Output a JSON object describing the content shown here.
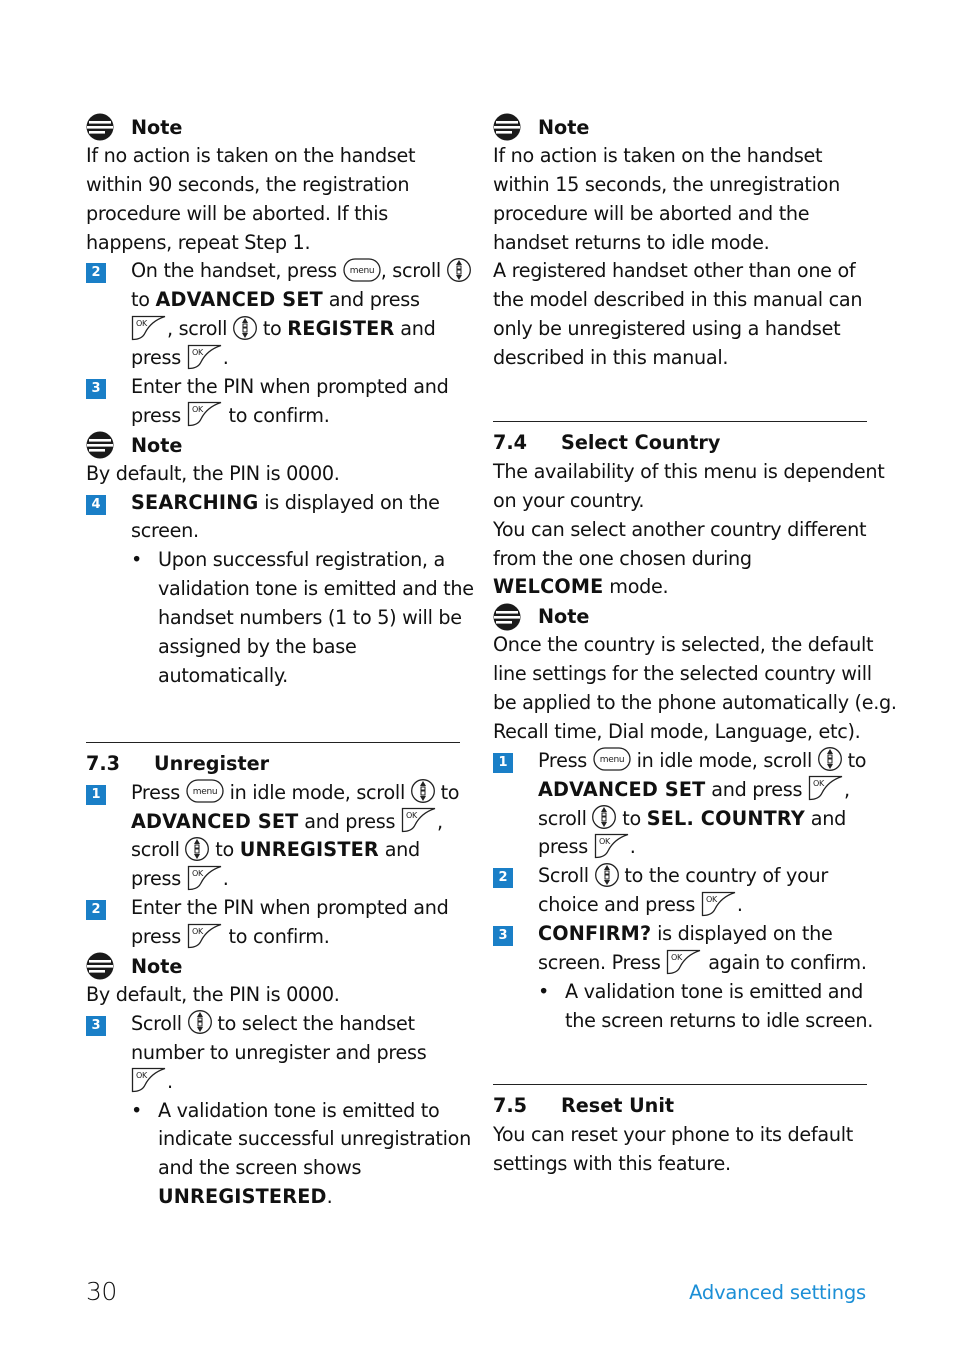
{
  "page": {
    "number": "30",
    "section_footer": "Advanced settings",
    "accent_color": "#1a7fc7",
    "footer_color": "#1c8fd6"
  },
  "icons": {
    "note": "note-icon",
    "menu_key": "menu",
    "ok_key": "OK",
    "scroll_key": "scroll-icon"
  },
  "left": {
    "note1": {
      "title": "Note",
      "lines": [
        "If no action is taken on the handset",
        "within 90 seconds, the registration",
        "procedure will be aborted. If this",
        "happens, repeat Step 1."
      ]
    },
    "step2": {
      "num": "2",
      "l1a": "On the handset, press ",
      "l1b": ", scroll ",
      "l2a": "to ",
      "l2b": "ADVANCED SET",
      "l2c": " and press",
      "l3a": ", scroll ",
      "l3b": " to ",
      "l3c": "REGISTER",
      "l3d": " and",
      "l4a": "press ",
      "l4b": "."
    },
    "step3": {
      "num": "3",
      "l1": "Enter the PIN when prompted and",
      "l2a": "press ",
      "l2b": " to confirm."
    },
    "note2": {
      "title": "Note",
      "text": "By default, the PIN is 0000."
    },
    "step4": {
      "num": "4",
      "l1a": "SEARCHING",
      "l1b": " is displayed on the",
      "l2": "screen.",
      "bullet": [
        "Upon successful registration, a",
        "validation tone is emitted and the",
        "handset numbers (1 to 5) will be",
        "assigned by the base",
        "automatically."
      ]
    },
    "sec73": {
      "num": "7.3",
      "title": "Unregister",
      "step1": {
        "num": "1",
        "l1a": "Press ",
        "l1b": " in idle mode, scroll ",
        "l1c": " to",
        "l2a": "ADVANCED SET",
        "l2b": " and press ",
        "l2c": ",",
        "l3a": "scroll ",
        "l3b": " to ",
        "l3c": "UNREGISTER",
        "l3d": " and",
        "l4a": "press ",
        "l4b": "."
      },
      "step2": {
        "num": "2",
        "l1": "Enter the PIN when prompted and",
        "l2a": "press ",
        "l2b": " to confirm."
      },
      "note": {
        "title": "Note",
        "text": "By default, the PIN is 0000."
      },
      "step3": {
        "num": "3",
        "l1a": "Scroll ",
        "l1b": " to select the handset",
        "l2": "number to unregister and press",
        "l3b": ".",
        "bullet": [
          "A validation tone is emitted to",
          "indicate successful unregistration",
          "and the screen shows"
        ],
        "bullet_last_bold": "UNREGISTERED",
        "bullet_last_end": "."
      }
    }
  },
  "right": {
    "note1": {
      "title": "Note",
      "lines": [
        "If no action is taken on the handset",
        "within 15 seconds, the unregistration",
        "procedure will be aborted and the",
        "handset returns to idle mode.",
        "A registered handset other than one of",
        "the model described in this manual can",
        "only be unregistered using a handset",
        "described in this manual."
      ]
    },
    "sec74": {
      "num": "7.4",
      "title": "Select Country",
      "intro": [
        "The availability of this menu is dependent",
        "on your country.",
        "You can select another country different",
        "from the one chosen during"
      ],
      "intro_bold": "WELCOME",
      "intro_end": " mode.",
      "note": {
        "title": "Note",
        "lines": [
          "Once the country is selected, the default",
          "line settings for the selected country will",
          "be applied to the phone automatically (e.g.",
          "Recall time, Dial mode, Language, etc)."
        ]
      },
      "step1": {
        "num": "1",
        "l1a": "Press ",
        "l1b": " in idle mode, scroll ",
        "l1c": " to",
        "l2a": "ADVANCED SET",
        "l2b": " and press ",
        "l2c": ",",
        "l3a": "scroll ",
        "l3b": " to ",
        "l3c": "SEL. COUNTRY",
        "l3d": " and",
        "l4a": "press ",
        "l4b": "."
      },
      "step2": {
        "num": "2",
        "l1a": "Scroll ",
        "l1b": " to the country of your",
        "l2a": "choice and press ",
        "l2b": "."
      },
      "step3": {
        "num": "3",
        "l1a": "CONFIRM?",
        "l1b": " is displayed on the",
        "l2a": "screen. Press ",
        "l2b": " again to confirm.",
        "bullet": [
          "A validation tone is emitted and",
          "the screen returns to idle screen."
        ]
      }
    },
    "sec75": {
      "num": "7.5",
      "title": "Reset Unit",
      "lines": [
        "You can reset your phone to its default",
        "settings with this feature."
      ]
    }
  }
}
